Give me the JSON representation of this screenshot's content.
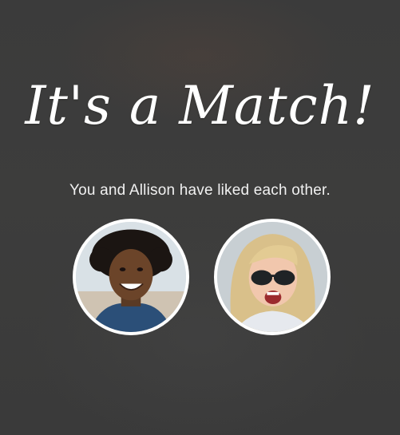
{
  "match": {
    "title": "It's a Match!",
    "subtitle": "You and Allison have liked each other."
  },
  "avatars": [
    {
      "name": "user-avatar"
    },
    {
      "name": "allison-avatar"
    }
  ],
  "colors": {
    "background": "#3a3a3a",
    "text": "#ffffff",
    "avatar_border": "#ffffff"
  }
}
